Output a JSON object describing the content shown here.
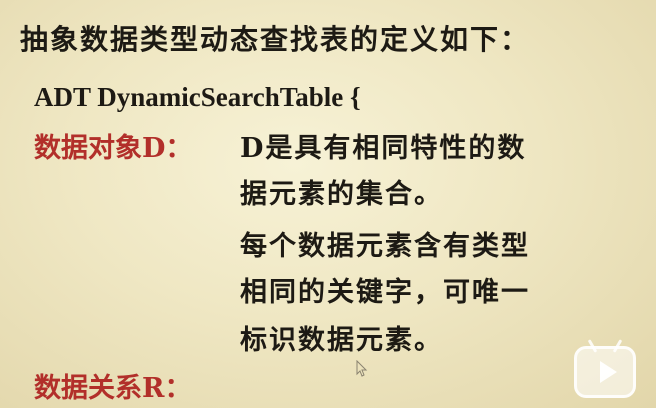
{
  "slide": {
    "title": "抽象数据类型动态查找表的定义如下：",
    "adt_header": "ADT DynamicSearchTable {",
    "data_object_label": "数据对象D：",
    "data_object_lines": [
      "D是具有相同特性的数",
      "据元素的集合。",
      "每个数据元素含有类型",
      "相同的关键字，可唯一",
      "标识数据元素。"
    ],
    "data_relation_label": "数据关系R："
  },
  "colors": {
    "label_red": "#b22f2a",
    "text": "#1d1a14",
    "background": "#efe7c3"
  },
  "icons": {
    "watermark": "bilibili-play-icon",
    "cursor": "mouse-cursor-icon"
  }
}
